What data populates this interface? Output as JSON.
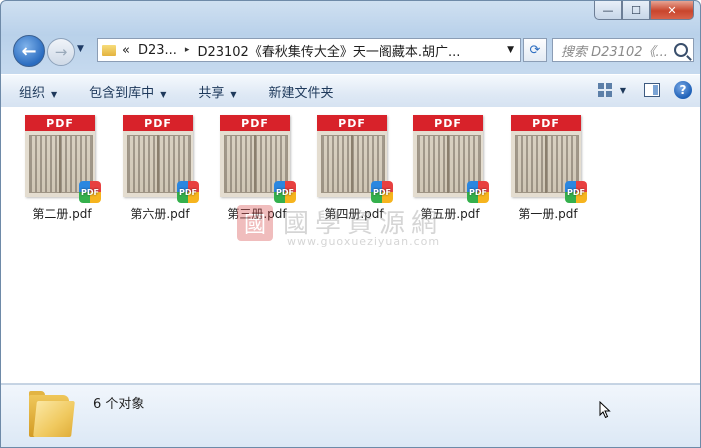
{
  "window": {
    "caption_min": "—",
    "caption_max": "☐",
    "caption_close": "✕"
  },
  "address": {
    "back_glyph": "←",
    "forward_glyph": "→",
    "parts": [
      "«",
      "D23...",
      "▸",
      "D23102《春秋集传大全》天一阁藏本.胡广..."
    ],
    "search_placeholder": "搜索 D23102《...",
    "refresh_glyph": "⟳"
  },
  "toolbar": {
    "organize": "组织",
    "include_library": "包含到库中",
    "share": "共享",
    "new_folder": "新建文件夹",
    "help_glyph": "?"
  },
  "files": [
    {
      "name": "第二册.pdf",
      "badge": "PDF"
    },
    {
      "name": "第六册.pdf",
      "badge": "PDF"
    },
    {
      "name": "第三册.pdf",
      "badge": "PDF"
    },
    {
      "name": "第四册.pdf",
      "badge": "PDF"
    },
    {
      "name": "第五册.pdf",
      "badge": "PDF"
    },
    {
      "name": "第一册.pdf",
      "badge": "PDF"
    }
  ],
  "watermark": {
    "seal": "國",
    "title": "國學資源網",
    "url": "www.guoxueziyuan.com"
  },
  "details": {
    "count_text": "6 个对象"
  }
}
